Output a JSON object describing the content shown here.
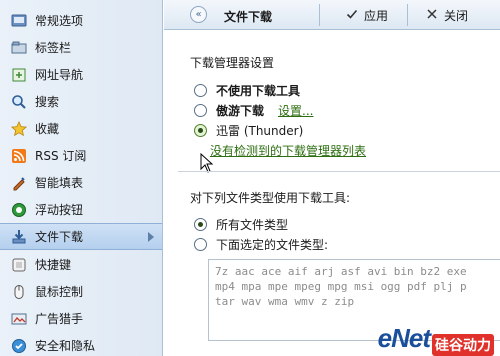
{
  "sidebar": {
    "items": [
      {
        "label": "常规选项",
        "icon": "general-icon"
      },
      {
        "label": "标签栏",
        "icon": "tab-bar-icon"
      },
      {
        "label": "网址导航",
        "icon": "url-nav-icon"
      },
      {
        "label": "搜索",
        "icon": "search-icon"
      },
      {
        "label": "收藏",
        "icon": "favorites-star-icon"
      },
      {
        "label": "RSS 订阅",
        "icon": "rss-icon"
      },
      {
        "label": "智能填表",
        "icon": "autofill-icon"
      },
      {
        "label": "浮动按钮",
        "icon": "float-button-icon"
      },
      {
        "label": "文件下载",
        "icon": "download-icon",
        "active": true
      },
      {
        "label": "快捷键",
        "icon": "shortcut-icon"
      },
      {
        "label": "鼠标控制",
        "icon": "mouse-icon"
      },
      {
        "label": "广告猎手",
        "icon": "ad-hunter-icon"
      },
      {
        "label": "安全和隐私",
        "icon": "security-icon"
      }
    ]
  },
  "toolbar": {
    "back_glyph": "«",
    "title": "文件下载",
    "apply_label": "应用",
    "close_label": "关闭"
  },
  "download_manager": {
    "section_title": "下载管理器设置",
    "options": [
      {
        "label": "不使用下载工具",
        "bold": true,
        "checked": false
      },
      {
        "label": "傲游下载",
        "bold": true,
        "checked": false,
        "link": "设置..."
      },
      {
        "label": "迅雷 (Thunder)",
        "bold": false,
        "checked": true
      }
    ],
    "detect_link": "没有检测到的下载管理器列表"
  },
  "file_types": {
    "section_title": "对下列文件类型使用下载工具:",
    "options": [
      {
        "label": "所有文件类型",
        "checked": true
      },
      {
        "label": "下面选定的文件类型:",
        "checked": false
      }
    ],
    "extensions_text": "7z aac ace aif arj asf avi bin bz2 exe\nmp4 mpa mpe mpeg mpg msi ogg pdf plj p\ntar wav wma wmv z zip"
  },
  "watermark": {
    "brand": "eNet",
    "sub": "硅谷动力"
  },
  "colors": {
    "accent": "#1c5fa8",
    "link_green": "#2c6e10",
    "sidebar_bg": "#e4edf7",
    "active_bg": "#c2d8f1"
  }
}
